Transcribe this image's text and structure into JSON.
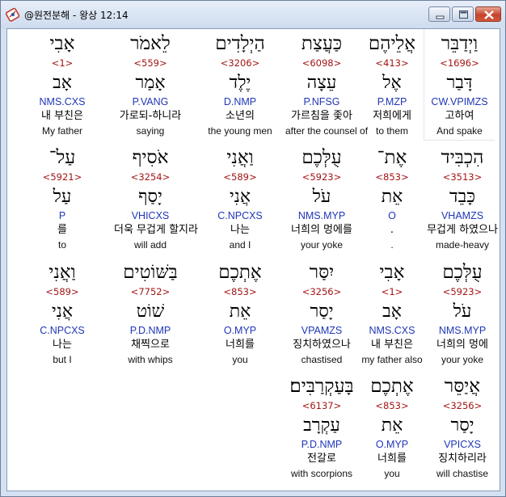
{
  "window": {
    "title": "@원전분해 - 왕상 12:14"
  },
  "rows": [
    [
      {
        "heb": "וַיְדַבֵּר",
        "num": "<1696>",
        "lemma": "דָּבַר",
        "parse": "CW.VPIMZS",
        "kor": "고하여",
        "eng": "And spake"
      },
      {
        "heb": "אֲלֵיהֶם",
        "num": "<413>",
        "lemma": "אֶל",
        "parse": "P.MZP",
        "kor": "저희에게",
        "eng": "to them"
      },
      {
        "heb": "כַּעֲצַת",
        "num": "<6098>",
        "lemma": "עֵצָה",
        "parse": "P.NFSG",
        "kor": "가르침을 좇아",
        "eng": "after the counsel of"
      },
      {
        "heb": "הַיְלָדִים",
        "num": "<3206>",
        "lemma": "יֶלֶד",
        "parse": "D.NMP",
        "kor": "소년의",
        "eng": "the young men"
      },
      {
        "heb": "לֵאמֹר",
        "num": "<559>",
        "lemma": "אָמַר",
        "parse": "P.VANG",
        "kor": "가로되-하니라",
        "eng": "saying"
      },
      {
        "heb": "אָבִי",
        "num": "<1>",
        "lemma": "אָב",
        "parse": "NMS.CXS",
        "kor": "내 부친은",
        "eng": "My father"
      }
    ],
    [
      {
        "heb": "הִכְבִּיד",
        "num": "<3513>",
        "lemma": "כָּבֵד",
        "parse": "VHAMZS",
        "kor": "무겁게 하였으나",
        "eng": "made-heavy"
      },
      {
        "heb": "אֶת־",
        "num": "<853>",
        "lemma": "אֵת",
        "parse": "O",
        "kor": ".",
        "eng": "."
      },
      {
        "heb": "עֻלְּכֶם",
        "num": "<5923>",
        "lemma": "עֹל",
        "parse": "NMS.MYP",
        "kor": "너희의 멍에를",
        "eng": "your yoke"
      },
      {
        "heb": "וַאֲנִי",
        "num": "<589>",
        "lemma": "אֲנִי",
        "parse": "C.NPCXS",
        "kor": "나는",
        "eng": "and I"
      },
      {
        "heb": "אֹסִיף",
        "num": "<3254>",
        "lemma": "יָסַף",
        "parse": "VHICXS",
        "kor": "더욱 무겁게 할지라",
        "eng": "will add"
      },
      {
        "heb": "עַל־",
        "num": "<5921>",
        "lemma": "עַל",
        "parse": "P",
        "kor": "를",
        "eng": "to"
      }
    ],
    [
      {
        "heb": "עֻלְּכֶם",
        "num": "<5923>",
        "lemma": "עֹל",
        "parse": "NMS.MYP",
        "kor": "너희의 멍에",
        "eng": "your yoke"
      },
      {
        "heb": "אָבִי",
        "num": "<1>",
        "lemma": "אָב",
        "parse": "NMS.CXS",
        "kor": "내 부친은",
        "eng": "my father also"
      },
      {
        "heb": "יִסַּר",
        "num": "<3256>",
        "lemma": "יָסַר",
        "parse": "VPAMZS",
        "kor": "징치하였으나",
        "eng": "chastised"
      },
      {
        "heb": "אֶתְכֶם",
        "num": "<853>",
        "lemma": "אֵת",
        "parse": "O.MYP",
        "kor": "너희를",
        "eng": "you"
      },
      {
        "heb": "בַּשּׁוֹטִים",
        "num": "<7752>",
        "lemma": "שׁוֹט",
        "parse": "P.D.NMP",
        "kor": "채찍으로",
        "eng": "with whips"
      },
      {
        "heb": "וַאֲנִי",
        "num": "<589>",
        "lemma": "אֲנִי",
        "parse": "C.NPCXS",
        "kor": "나는",
        "eng": "but I"
      }
    ],
    [
      {
        "heb": "אֲיַסֵּר",
        "num": "<3256>",
        "lemma": "יָסַר",
        "parse": "VPICXS",
        "kor": "징치하리라",
        "eng": "will chastise"
      },
      {
        "heb": "אֶתְכֶם",
        "num": "<853>",
        "lemma": "אֵת",
        "parse": "O.MYP",
        "kor": "너희를",
        "eng": "you"
      },
      {
        "heb": "בָּעַקְרַבִּים׃",
        "num": "<6137>",
        "lemma": "עַקְרָב",
        "parse": "P.D.NMP",
        "kor": "전갈로",
        "eng": "with scorpions"
      }
    ]
  ],
  "colors": {
    "hebrew": "#000000",
    "strong_number": "#a31515",
    "parsing": "#1f36b8",
    "korean": "#000000",
    "english": "#111111"
  },
  "icons": {
    "app": "bible-app-icon",
    "minimize": "minimize-icon",
    "maximize": "maximize-icon",
    "close": "close-icon"
  }
}
